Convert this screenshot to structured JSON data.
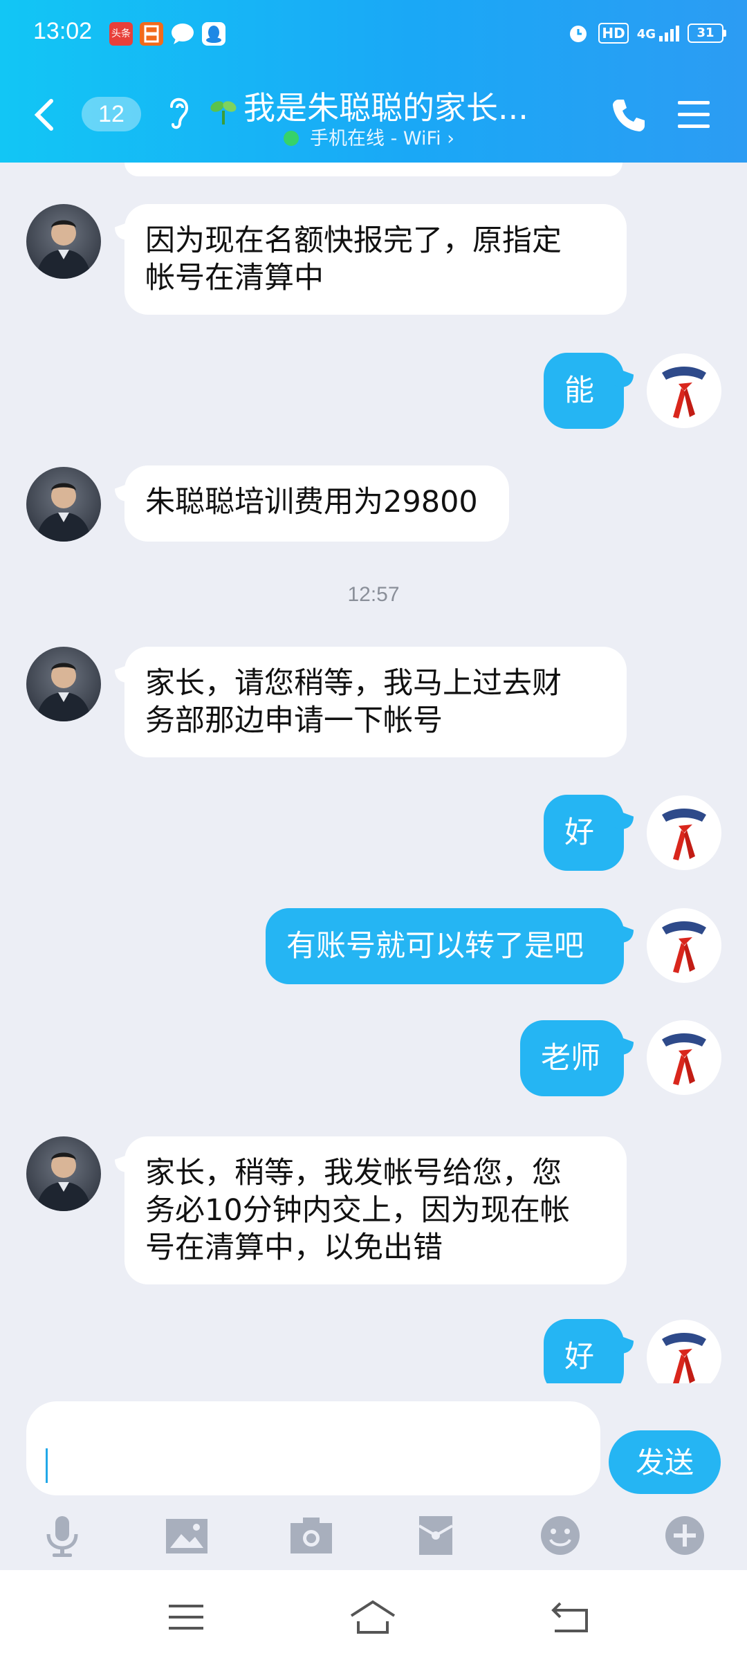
{
  "status_bar": {
    "time": "13:02",
    "icon_toutiao": "头条",
    "network": "HD",
    "signal": "4G",
    "battery": "31"
  },
  "header": {
    "unread_count": "12",
    "title": "我是朱聪聪的家长...",
    "subtitle": "手机在线 - WiFi",
    "colors": {
      "gradient_start": "#12c6f5",
      "gradient_end": "#2c9cf3"
    }
  },
  "messages": [
    {
      "side": "in",
      "text_lines": [
        "因为现在名额快报完了，原指定",
        "帐号在清算中"
      ]
    },
    {
      "side": "out",
      "text": "能"
    },
    {
      "side": "in",
      "text_lines": [
        "朱聪聪培训费用为29800"
      ]
    },
    {
      "timestamp": "12:57"
    },
    {
      "side": "in",
      "text_lines": [
        "家长，请您稍等，我马上过去财",
        "务部那边申请一下帐号"
      ]
    },
    {
      "side": "out",
      "text": "好"
    },
    {
      "side": "out",
      "text": "有账号就可以转了是吧"
    },
    {
      "side": "out",
      "text": "老师"
    },
    {
      "side": "in",
      "text_lines": [
        "家长，稍等，我发帐号给您，您",
        "务必10分钟内交上，因为现在帐",
        "号在清算中，以免出错"
      ]
    },
    {
      "side": "out",
      "text": "好"
    }
  ],
  "input": {
    "value": "",
    "send_label": "发送"
  },
  "toolbar": [
    "microphone-icon",
    "image-icon",
    "camera-icon",
    "red-packet-icon",
    "emoji-icon",
    "plus-icon"
  ],
  "colors": {
    "bubble_out": "#25b5f3",
    "bubble_in": "#ffffff",
    "background": "#eceef5"
  }
}
